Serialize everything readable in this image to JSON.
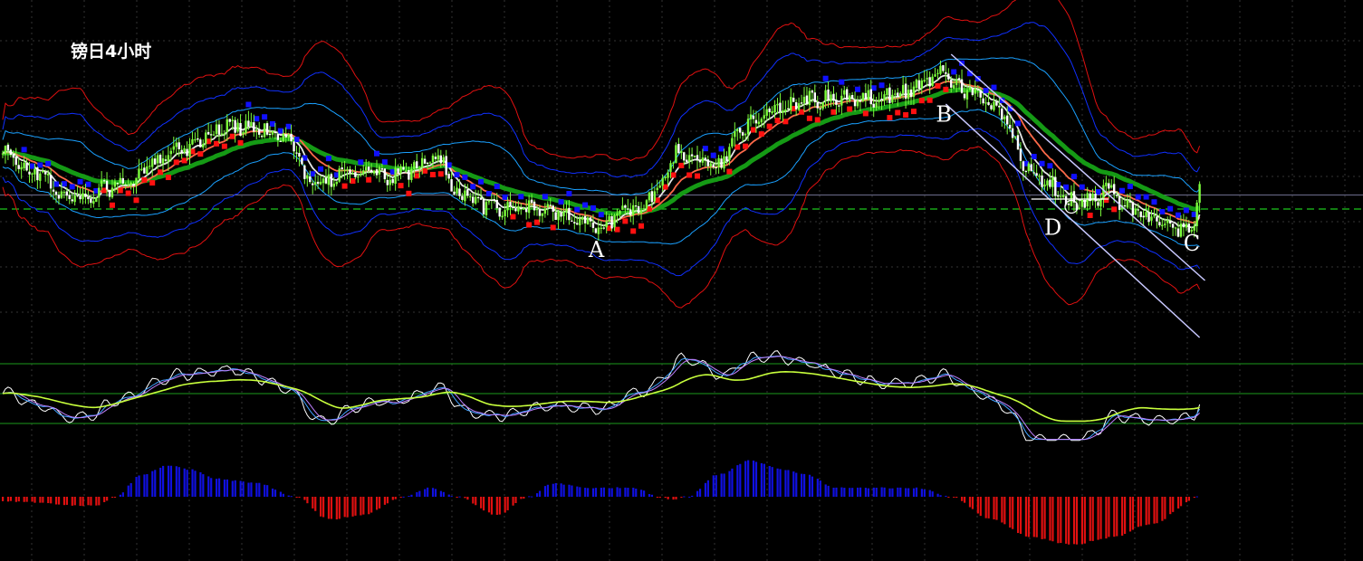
{
  "title": "镑日4小时",
  "points": [
    {
      "label": "A",
      "x": 222,
      "y": 13.1
    },
    {
      "label": "B",
      "x": 352,
      "y": 24.35
    },
    {
      "label": "C",
      "x": 446,
      "y": 13.5
    },
    {
      "label": "D",
      "x": 400,
      "y": 15.65
    }
  ],
  "colors": {
    "background": "#000000",
    "grid": "#343434",
    "bull_candle": "#7cfc3c",
    "bear_candle": "#ffffff",
    "ma_fast": "#e6e6e6",
    "ma_mid": "#ff6a4a",
    "ma_slow": "#159a15",
    "band_inner": "#1aa0ff",
    "band_mid": "#1030ff",
    "band_outer": "#e01010",
    "sar_up": "#ff1010",
    "sar_down": "#1010ff",
    "channel": "#c8c8ff",
    "macd_up": "#1010e0",
    "macd_down": "#e01010",
    "osc_level": "#1c9a1c",
    "dashed_level": "#1cc81c"
  },
  "chart_data": {
    "type": "candlestick",
    "title": "镑日4小时",
    "x_range": [
      0,
      448
    ],
    "y_range": [
      0,
      38
    ],
    "grid": true,
    "price_keypoints": [
      [
        0,
        21
      ],
      [
        12,
        19
      ],
      [
        25,
        16
      ],
      [
        45,
        17.5
      ],
      [
        65,
        21.5
      ],
      [
        85,
        24
      ],
      [
        100,
        23.5
      ],
      [
        108,
        22.5
      ],
      [
        115,
        17.5
      ],
      [
        130,
        19
      ],
      [
        145,
        18.5
      ],
      [
        165,
        20.5
      ],
      [
        168,
        17
      ],
      [
        185,
        14.8
      ],
      [
        200,
        15
      ],
      [
        222,
        13.1
      ],
      [
        238,
        15
      ],
      [
        245,
        17.2
      ],
      [
        252,
        21
      ],
      [
        268,
        19.5
      ],
      [
        275,
        24
      ],
      [
        290,
        26
      ],
      [
        300,
        27
      ],
      [
        318,
        27
      ],
      [
        335,
        27.5
      ],
      [
        352,
        30
      ],
      [
        360,
        28
      ],
      [
        372,
        26
      ],
      [
        385,
        19
      ],
      [
        400,
        15.8
      ],
      [
        405,
        15.65
      ],
      [
        415,
        17
      ],
      [
        420,
        15
      ],
      [
        430,
        14
      ],
      [
        440,
        12.5
      ],
      [
        446,
        13.5
      ],
      [
        448,
        17.5
      ]
    ],
    "histogram_keypoints": [
      [
        0,
        -0.5
      ],
      [
        35,
        -1
      ],
      [
        42,
        0
      ],
      [
        52,
        2.4
      ],
      [
        62,
        3.5
      ],
      [
        70,
        3
      ],
      [
        80,
        2
      ],
      [
        95,
        1.5
      ],
      [
        110,
        0
      ],
      [
        122,
        -2.5
      ],
      [
        135,
        -2
      ],
      [
        150,
        0
      ],
      [
        160,
        1
      ],
      [
        170,
        0
      ],
      [
        185,
        -2
      ],
      [
        197,
        0
      ],
      [
        206,
        1.5
      ],
      [
        220,
        1
      ],
      [
        236,
        1
      ],
      [
        246,
        0
      ],
      [
        250,
        -0.3
      ],
      [
        256,
        0
      ],
      [
        268,
        2.5
      ],
      [
        280,
        4
      ],
      [
        292,
        3
      ],
      [
        300,
        2.5
      ],
      [
        312,
        1
      ],
      [
        325,
        1
      ],
      [
        342,
        1
      ],
      [
        355,
        0
      ],
      [
        370,
        -2.5
      ],
      [
        385,
        -4.5
      ],
      [
        400,
        -5.3
      ],
      [
        415,
        -4.5
      ],
      [
        430,
        -3
      ],
      [
        448,
        0
      ]
    ],
    "oscillator_levels": [
      80,
      50,
      20
    ],
    "series": [
      {
        "type": "candles"
      },
      {
        "type": "line",
        "key": "ma_fast"
      },
      {
        "type": "line",
        "key": "ma_mid"
      },
      {
        "type": "line",
        "key": "ma_slow"
      },
      {
        "type": "band",
        "key": "band_inner"
      },
      {
        "type": "band",
        "key": "band_mid"
      },
      {
        "type": "band",
        "key": "band_outer"
      },
      {
        "type": "markers",
        "key": "sar"
      },
      {
        "type": "histogram",
        "key": "macd"
      },
      {
        "type": "oscillator",
        "key": "osc"
      }
    ],
    "reference_price": 14.9,
    "support_level": 16.0,
    "channel": {
      "x1": 355,
      "x2": 450,
      "upper_y1": 32.0,
      "upper_y2": 7.0,
      "lower_y1": 26.5,
      "lower_y2": 0.7
    }
  }
}
